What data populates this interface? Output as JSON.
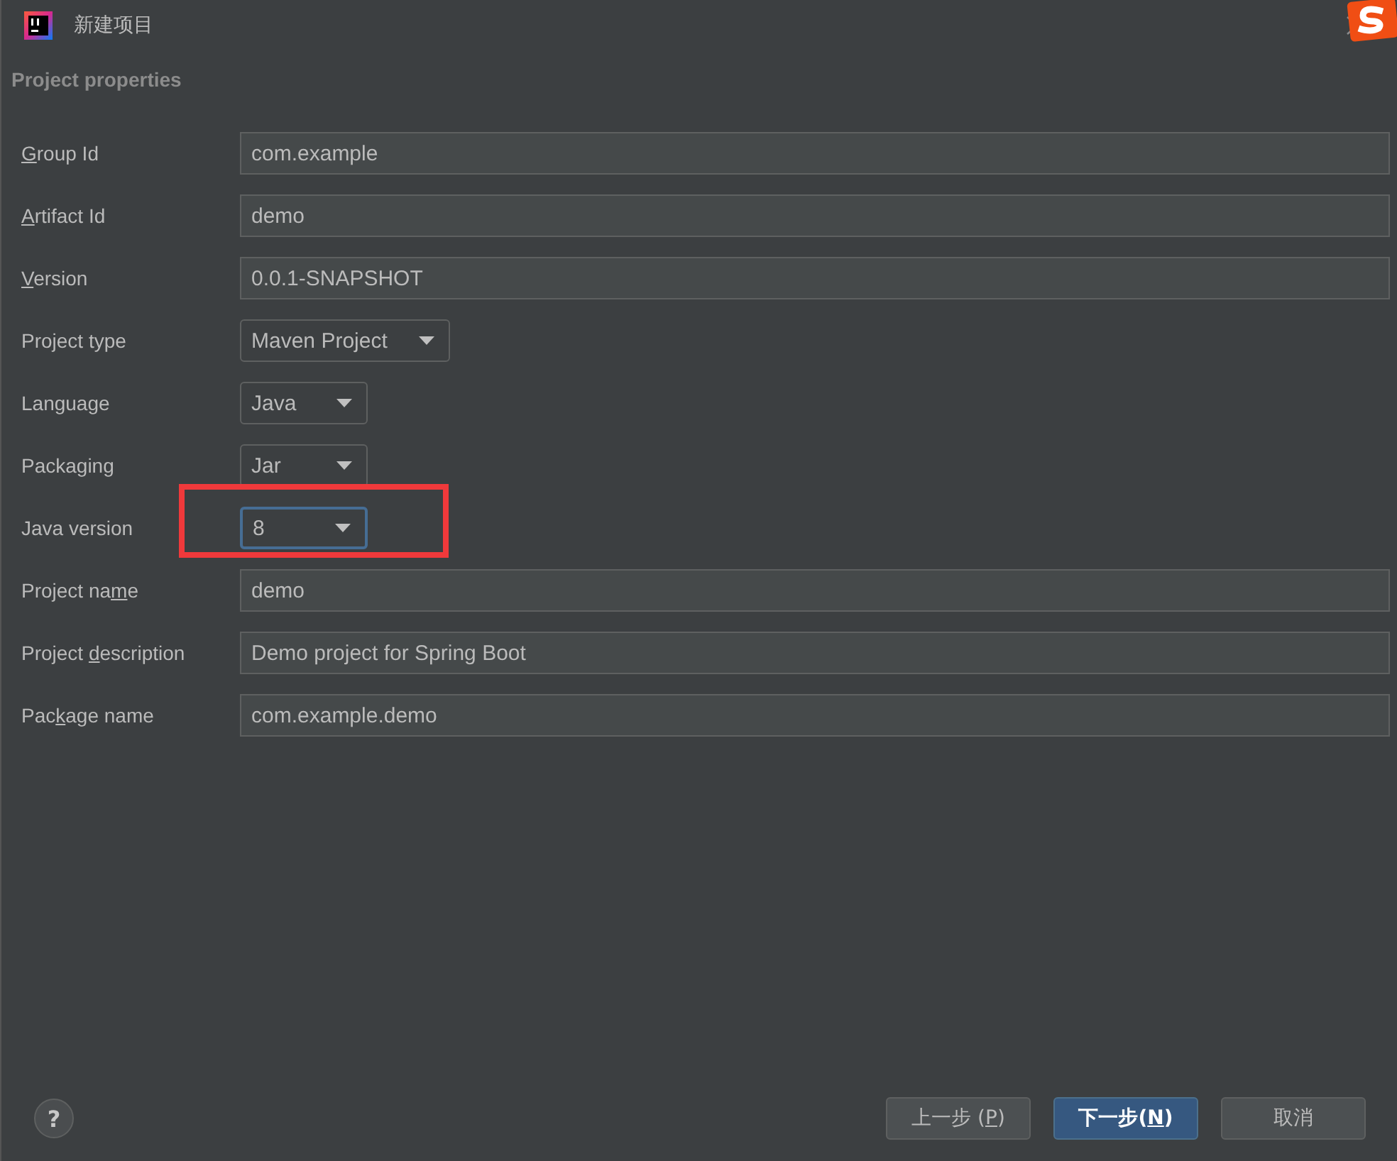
{
  "window": {
    "title": "新建项目"
  },
  "section_title": "Project properties",
  "fields": [
    {
      "label": {
        "key": "G",
        "after": "roup Id"
      },
      "kind": "text",
      "value": "com.example",
      "focused": false,
      "highlighted": false
    },
    {
      "label": {
        "key": "A",
        "after": "rtifact Id"
      },
      "kind": "text",
      "value": "demo",
      "focused": false,
      "highlighted": false
    },
    {
      "label": {
        "key": "V",
        "after": "ersion"
      },
      "kind": "text",
      "value": "0.0.1-SNAPSHOT",
      "focused": false,
      "highlighted": false
    },
    {
      "label": {
        "before": "Project type"
      },
      "kind": "dropdown",
      "value": "Maven Project",
      "focused": false,
      "highlighted": false
    },
    {
      "label": {
        "before": "Language"
      },
      "kind": "dropdown",
      "value": "Java",
      "focused": false,
      "highlighted": false
    },
    {
      "label": {
        "before": "Packaging"
      },
      "kind": "dropdown",
      "value": "Jar",
      "focused": false,
      "highlighted": false
    },
    {
      "label": {
        "before": "Java version"
      },
      "kind": "dropdown",
      "value": "8",
      "focused": true,
      "highlighted": true
    },
    {
      "label": {
        "before": "Project na",
        "key": "m",
        "after": "e"
      },
      "kind": "text",
      "value": "demo",
      "focused": false,
      "highlighted": false
    },
    {
      "label": {
        "before": "Project ",
        "key": "d",
        "after": "escription"
      },
      "kind": "text",
      "value": "Demo project for Spring Boot",
      "focused": false,
      "highlighted": false
    },
    {
      "label": {
        "before": "Pac",
        "key": "k",
        "after": "age name"
      },
      "kind": "text",
      "value": "com.example.demo",
      "focused": false,
      "highlighted": false
    }
  ],
  "help_button": "?",
  "buttons": [
    {
      "label": {
        "before": "上一步 (",
        "key": "P",
        "after": ")"
      },
      "primary": false
    },
    {
      "label": {
        "before": "下一步(",
        "key": "N",
        "after": ")"
      },
      "primary": true
    },
    {
      "label": {
        "before": "取消"
      },
      "primary": false
    }
  ]
}
